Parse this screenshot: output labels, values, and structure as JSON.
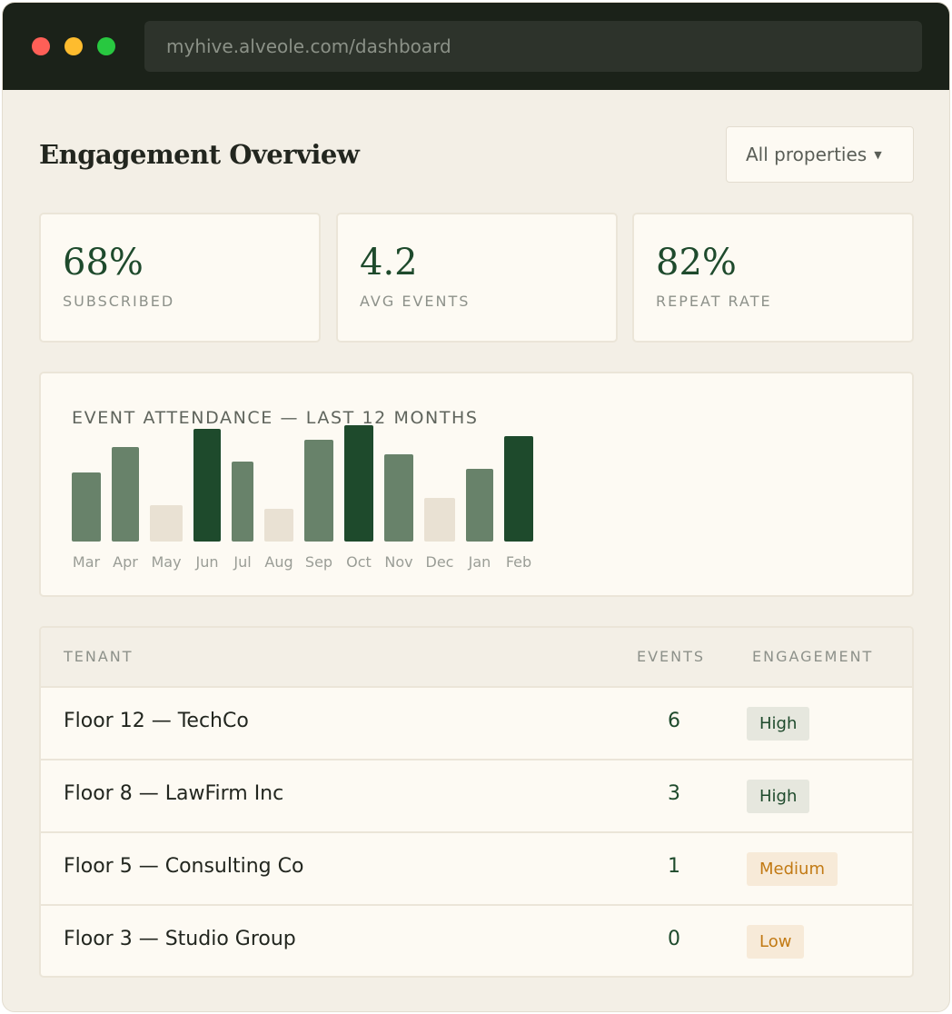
{
  "browser": {
    "url": "myhive.alveole.com/dashboard"
  },
  "header": {
    "title": "Engagement Overview",
    "property_select": "All properties"
  },
  "stats": [
    {
      "value": "68%",
      "label": "SUBSCRIBED"
    },
    {
      "value": "4.2",
      "label": "AVG EVENTS"
    },
    {
      "value": "82%",
      "label": "REPEAT RATE"
    }
  ],
  "chart_data": {
    "type": "bar",
    "title": "EVENT ATTENDANCE — LAST 12 MONTHS",
    "categories": [
      "Mar",
      "Apr",
      "May",
      "Jun",
      "Jul",
      "Aug",
      "Sep",
      "Oct",
      "Nov",
      "Dec",
      "Jan",
      "Feb"
    ],
    "values": [
      76,
      104,
      40,
      124,
      88,
      36,
      112,
      128,
      96,
      48,
      80,
      116
    ],
    "levels": [
      "medium",
      "medium",
      "low",
      "high",
      "medium",
      "low",
      "medium",
      "high",
      "medium",
      "low",
      "medium",
      "high"
    ],
    "ylim": [
      0,
      128
    ],
    "grid": false,
    "colors": {
      "high": "#1e4a2c",
      "medium": "#68826a",
      "low": "#e9e1d3",
      "tick": "#9a9d96"
    }
  },
  "table": {
    "headers": {
      "tenant": "TENANT",
      "events": "EVENTS",
      "engagement": "ENGAGEMENT"
    },
    "rows": [
      {
        "tenant": "Floor 12 — TechCo",
        "events": "6",
        "engagement": "High",
        "level": "high"
      },
      {
        "tenant": "Floor 8 — LawFirm Inc",
        "events": "3",
        "engagement": "High",
        "level": "high"
      },
      {
        "tenant": "Floor 5 — Consulting Co",
        "events": "1",
        "engagement": "Medium",
        "level": "medium"
      },
      {
        "tenant": "Floor 3 — Studio Group",
        "events": "0",
        "engagement": "Low",
        "level": "low"
      }
    ]
  }
}
